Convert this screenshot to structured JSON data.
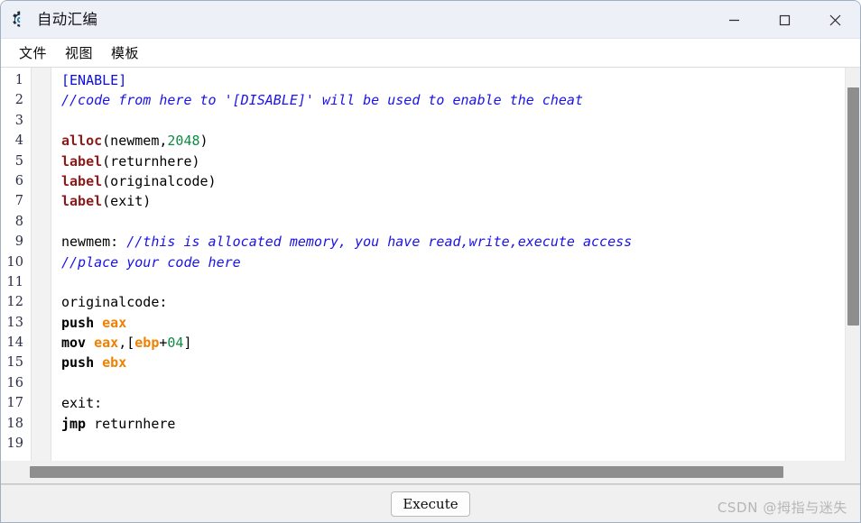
{
  "window": {
    "title": "自动汇编",
    "icon": "gear-icon",
    "controls": {
      "minimize": "minimize-icon",
      "maximize": "maximize-icon",
      "close": "close-icon"
    }
  },
  "menubar": {
    "items": [
      {
        "label": "文件"
      },
      {
        "label": "视图"
      },
      {
        "label": "模板"
      }
    ]
  },
  "editor": {
    "line_numbers": [
      "1",
      "2",
      "3",
      "4",
      "5",
      "6",
      "7",
      "8",
      "9",
      "10",
      "11",
      "12",
      "13",
      "14",
      "15",
      "16",
      "17",
      "18",
      "19"
    ],
    "lines": [
      {
        "n": "1",
        "text": "[ENABLE]"
      },
      {
        "n": "2",
        "text": "//code from here to '[DISABLE]' will be used to enable the cheat"
      },
      {
        "n": "3",
        "text": ""
      },
      {
        "n": "4",
        "text": "alloc(newmem,2048)"
      },
      {
        "n": "5",
        "text": "label(returnhere)"
      },
      {
        "n": "6",
        "text": "label(originalcode)"
      },
      {
        "n": "7",
        "text": "label(exit)"
      },
      {
        "n": "8",
        "text": ""
      },
      {
        "n": "9",
        "text": "newmem: //this is allocated memory, you have read,write,execute access"
      },
      {
        "n": "10",
        "text": "//place your code here"
      },
      {
        "n": "11",
        "text": ""
      },
      {
        "n": "12",
        "text": "originalcode:"
      },
      {
        "n": "13",
        "text": "push eax"
      },
      {
        "n": "14",
        "text": "mov eax,[ebp+04]"
      },
      {
        "n": "15",
        "text": "push ebx"
      },
      {
        "n": "16",
        "text": ""
      },
      {
        "n": "17",
        "text": "exit:"
      },
      {
        "n": "18",
        "text": "jmp returnhere"
      },
      {
        "n": "19",
        "text": ""
      }
    ],
    "tokens": [
      [
        {
          "t": "[ENABLE]",
          "c": "sec"
        }
      ],
      [
        {
          "t": "//code from here to '[DISABLE]' will be used to enable the cheat",
          "c": "cmt"
        }
      ],
      [],
      [
        {
          "t": "alloc",
          "c": "kw"
        },
        {
          "t": "(newmem,",
          "c": "plain"
        },
        {
          "t": "2048",
          "c": "num"
        },
        {
          "t": ")",
          "c": "plain"
        }
      ],
      [
        {
          "t": "label",
          "c": "kw"
        },
        {
          "t": "(returnhere)",
          "c": "plain"
        }
      ],
      [
        {
          "t": "label",
          "c": "kw"
        },
        {
          "t": "(originalcode)",
          "c": "plain"
        }
      ],
      [
        {
          "t": "label",
          "c": "kw"
        },
        {
          "t": "(exit)",
          "c": "plain"
        }
      ],
      [],
      [
        {
          "t": "newmem: ",
          "c": "plain"
        },
        {
          "t": "//this is allocated memory, you have read,write,execute access",
          "c": "cmt"
        }
      ],
      [
        {
          "t": "//place your code here",
          "c": "cmt"
        }
      ],
      [],
      [
        {
          "t": "originalcode:",
          "c": "plain"
        }
      ],
      [
        {
          "t": "push",
          "c": "ins"
        },
        {
          "t": " ",
          "c": "plain"
        },
        {
          "t": "eax",
          "c": "reg"
        }
      ],
      [
        {
          "t": "mov",
          "c": "ins"
        },
        {
          "t": " ",
          "c": "plain"
        },
        {
          "t": "eax",
          "c": "reg"
        },
        {
          "t": ",[",
          "c": "plain"
        },
        {
          "t": "ebp",
          "c": "reg"
        },
        {
          "t": "+",
          "c": "plain"
        },
        {
          "t": "04",
          "c": "num"
        },
        {
          "t": "]",
          "c": "plain"
        }
      ],
      [
        {
          "t": "push",
          "c": "ins"
        },
        {
          "t": " ",
          "c": "plain"
        },
        {
          "t": "ebx",
          "c": "reg"
        }
      ],
      [],
      [
        {
          "t": "exit:",
          "c": "plain"
        }
      ],
      [
        {
          "t": "jmp",
          "c": "ins"
        },
        {
          "t": " returnhere",
          "c": "plain"
        }
      ],
      []
    ],
    "scrollbars": {
      "vertical": "vertical-scrollbar",
      "horizontal": "horizontal-scrollbar"
    }
  },
  "footer": {
    "execute_label": "Execute",
    "watermark": "CSDN @拇指与迷失"
  },
  "colors": {
    "titlebar_bg": "#edf1f7",
    "keyword": "#8b1a1a",
    "register": "#f08000",
    "number": "#0f8a42",
    "comment": "#1b12e8",
    "section": "#0b0ce0",
    "scrollbar_thumb": "#8e8e8e"
  }
}
